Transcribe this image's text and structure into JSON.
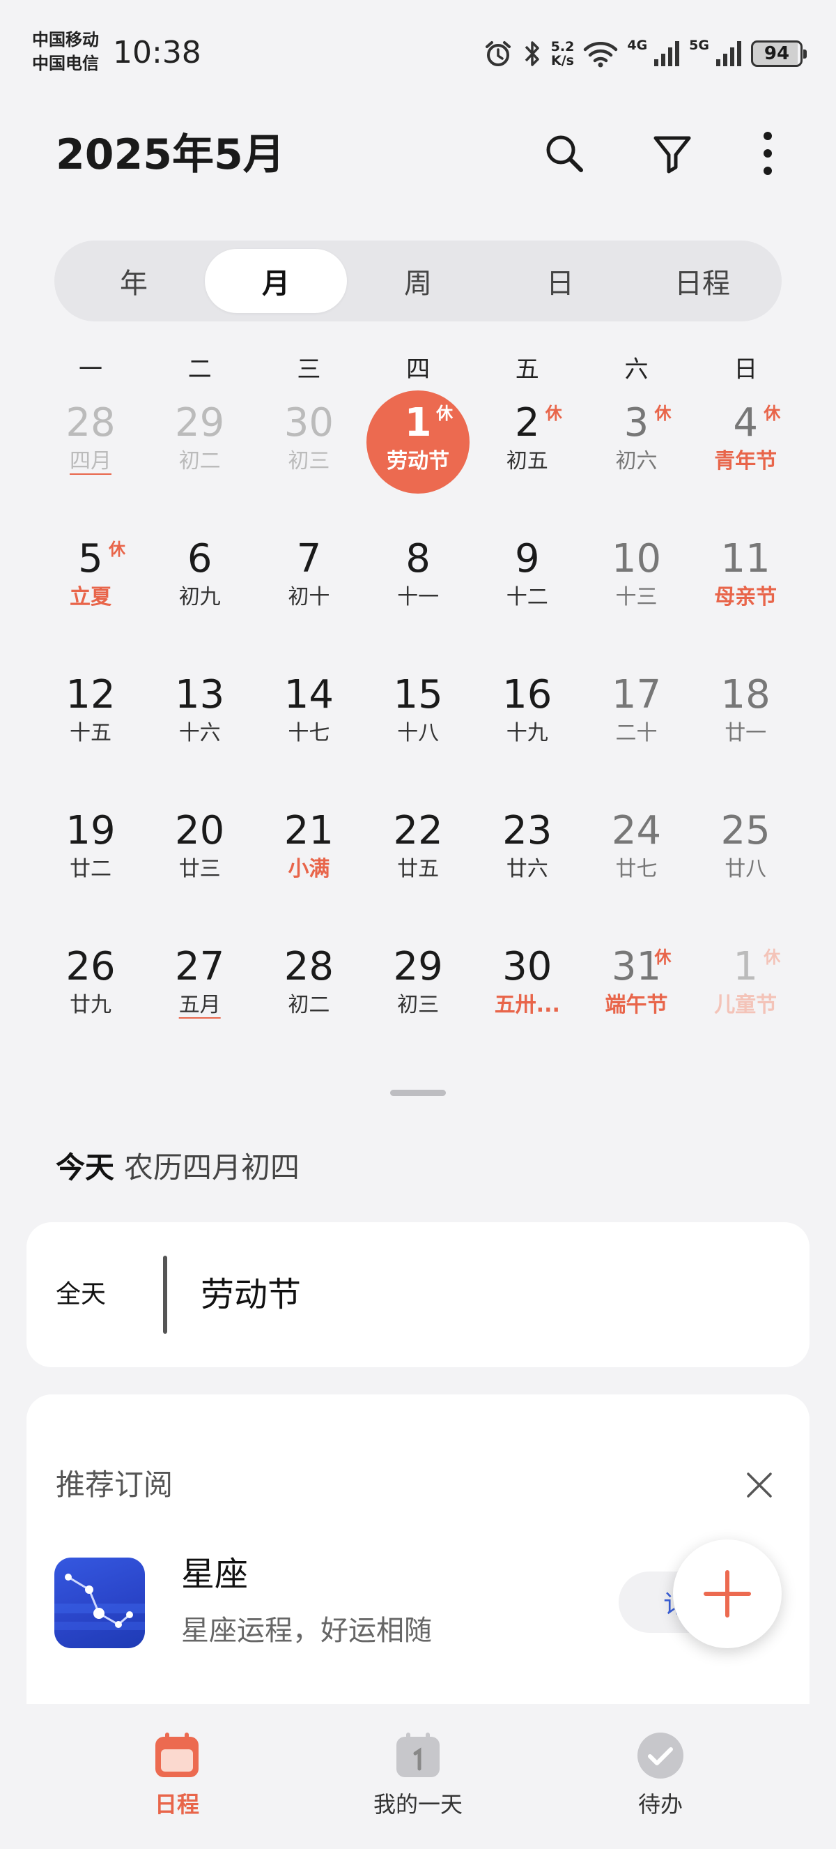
{
  "status_bar": {
    "carrier1": "中国移动",
    "carrier2": "中国电信",
    "time": "10:38",
    "net_speed_value": "5.2",
    "net_speed_unit": "K/s",
    "sig1_label": "4G",
    "sig2_label": "5G",
    "battery": "94"
  },
  "header": {
    "title": "2025年5月"
  },
  "views": [
    "年",
    "月",
    "周",
    "日",
    "日程"
  ],
  "weekdays": [
    "一",
    "二",
    "三",
    "四",
    "五",
    "六",
    "日"
  ],
  "weeks": [
    [
      {
        "n": "28",
        "l": "四月",
        "other": true,
        "ul": true
      },
      {
        "n": "29",
        "l": "初二",
        "other": true
      },
      {
        "n": "30",
        "l": "初三",
        "other": true
      },
      {
        "n": "1",
        "l": "劳动节",
        "rest": "休",
        "today": true
      },
      {
        "n": "2",
        "l": "初五",
        "rest": "休"
      },
      {
        "n": "3",
        "l": "初六",
        "rest": "休",
        "weekend": true
      },
      {
        "n": "4",
        "l": "青年节",
        "rest": "休",
        "weekend": true,
        "hol": true
      }
    ],
    [
      {
        "n": "5",
        "l": "立夏",
        "rest": "休",
        "hol": true
      },
      {
        "n": "6",
        "l": "初九"
      },
      {
        "n": "7",
        "l": "初十"
      },
      {
        "n": "8",
        "l": "十一"
      },
      {
        "n": "9",
        "l": "十二"
      },
      {
        "n": "10",
        "l": "十三",
        "weekend": true
      },
      {
        "n": "11",
        "l": "母亲节",
        "weekend": true,
        "hol": true
      }
    ],
    [
      {
        "n": "12",
        "l": "十五"
      },
      {
        "n": "13",
        "l": "十六"
      },
      {
        "n": "14",
        "l": "十七"
      },
      {
        "n": "15",
        "l": "十八"
      },
      {
        "n": "16",
        "l": "十九"
      },
      {
        "n": "17",
        "l": "二十",
        "weekend": true
      },
      {
        "n": "18",
        "l": "廿一",
        "weekend": true
      }
    ],
    [
      {
        "n": "19",
        "l": "廿二"
      },
      {
        "n": "20",
        "l": "廿三"
      },
      {
        "n": "21",
        "l": "小满",
        "hol": true
      },
      {
        "n": "22",
        "l": "廿五"
      },
      {
        "n": "23",
        "l": "廿六"
      },
      {
        "n": "24",
        "l": "廿七",
        "weekend": true
      },
      {
        "n": "25",
        "l": "廿八",
        "weekend": true
      }
    ],
    [
      {
        "n": "26",
        "l": "廿九"
      },
      {
        "n": "27",
        "l": "五月",
        "ul": true
      },
      {
        "n": "28",
        "l": "初二"
      },
      {
        "n": "29",
        "l": "初三"
      },
      {
        "n": "30",
        "l": "五卅...",
        "hol": true
      },
      {
        "n": "31",
        "l": "端午节",
        "rest": "休",
        "weekend": true,
        "hol": true
      },
      {
        "n": "1",
        "l": "儿童节",
        "rest": "休",
        "other": true,
        "hol": true
      }
    ]
  ],
  "today": {
    "label": "今天",
    "lunar": "农历四月初四"
  },
  "event": {
    "time": "全天",
    "title": "劳动节"
  },
  "recommend": {
    "title": "推荐订阅",
    "name": "星座",
    "desc": "星座运程，好运相随",
    "button": "订阅"
  },
  "nav": [
    {
      "label": "日程",
      "icon": "calendar-icon"
    },
    {
      "label": "我的一天",
      "icon": "my-day-icon"
    },
    {
      "label": "待办",
      "icon": "todo-check-icon"
    }
  ],
  "colors": {
    "accent": "#ec6a50",
    "link": "#3a5fd9"
  }
}
